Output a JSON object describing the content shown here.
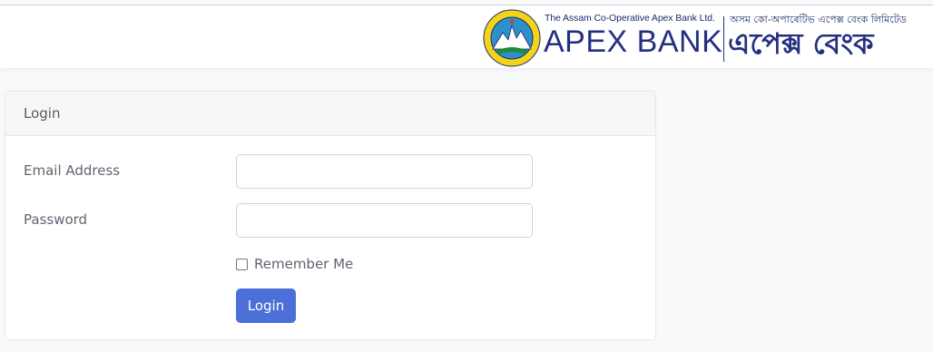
{
  "brand": {
    "english_small": "The Assam Co-Operative Apex Bank Ltd.",
    "english_big": "APEX BANK",
    "assamese_small": "অসম কো-অপাৰেটিভ এপেক্স বেংক লিমিটেড",
    "assamese_big": "এপেক্স বেংক",
    "seal_text": "THE ASSAM CO-OPERATIVE APEX BANK LIMITED"
  },
  "card": {
    "title": "Login"
  },
  "form": {
    "email_label": "Email Address",
    "email_value": "",
    "password_label": "Password",
    "password_value": "",
    "remember_label": "Remember Me",
    "remember_checked": false,
    "submit_label": "Login"
  },
  "colors": {
    "primary": "#4c6fd8",
    "brand_navy": "#233080",
    "seal_yellow": "#f2d51b",
    "seal_green": "#1f8a3c"
  }
}
